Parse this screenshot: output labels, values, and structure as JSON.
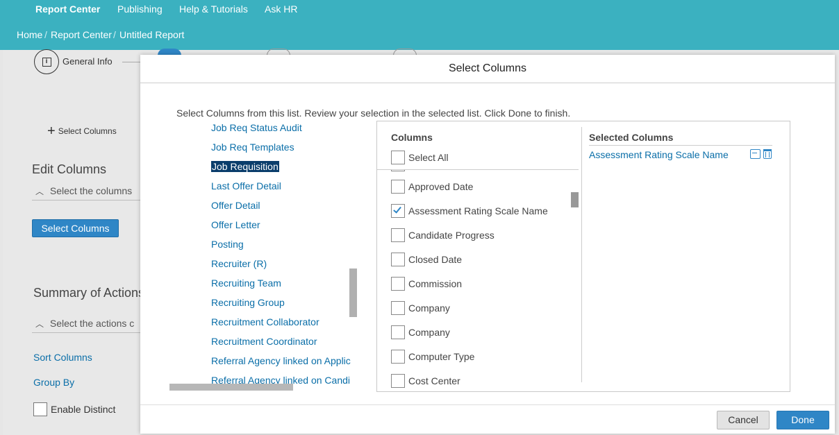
{
  "topnav": {
    "items": [
      "Report Center",
      "Publishing",
      "Help & Tutorials",
      "Ask HR"
    ]
  },
  "breadcrumb": {
    "items": [
      "Home",
      "Report Center",
      "Untitled Report"
    ]
  },
  "wizard": {
    "step1_label": "General Info"
  },
  "background": {
    "add_select_columns": "Select Columns",
    "edit_columns_heading": "Edit Columns",
    "edit_columns_sub": "Select the columns",
    "select_columns_button": "Select Columns",
    "summary_heading": "Summary of Actions",
    "summary_sub": "Select the actions c",
    "sort_columns": "Sort Columns",
    "group_by": "Group By",
    "enable_distinct": "Enable Distinct"
  },
  "modal": {
    "title": "Select Columns",
    "instructions": "Select Columns from this list. Review your selection in the selected list. Click Done to finish.",
    "categories": [
      "Job Req Status Audit",
      "Job Req Templates",
      "Job Requisition",
      "Last Offer Detail",
      "Offer Detail",
      "Offer Letter",
      "Posting",
      "Recruiter (R)",
      "Recruiting Team",
      "Recruiting Group",
      "Recruitment Collaborator",
      "Recruitment Coordinator",
      "Referral Agency linked on Applic",
      "Referral Agency linked on Candi"
    ],
    "selected_category": "Job Requisition",
    "columns_heading": "Columns",
    "select_all_label": "Select All",
    "columns": [
      {
        "label": "Approved Date",
        "checked": false
      },
      {
        "label": "Assessment Rating Scale Name",
        "checked": true
      },
      {
        "label": "Candidate Progress",
        "checked": false
      },
      {
        "label": "Closed Date",
        "checked": false
      },
      {
        "label": "Commission",
        "checked": false
      },
      {
        "label": "Company",
        "checked": false
      },
      {
        "label": "Company",
        "checked": false
      },
      {
        "label": "Computer Type",
        "checked": false
      },
      {
        "label": "Cost Center",
        "checked": false
      }
    ],
    "selected_heading": "Selected Columns",
    "selected_items": [
      "Assessment Rating Scale Name"
    ],
    "cancel_label": "Cancel",
    "done_label": "Done"
  },
  "colors": {
    "header": "#3bb1c0",
    "link": "#0a6ea8",
    "primary_button": "#2f86c6",
    "selected_category_bg": "#0a3d6b"
  }
}
